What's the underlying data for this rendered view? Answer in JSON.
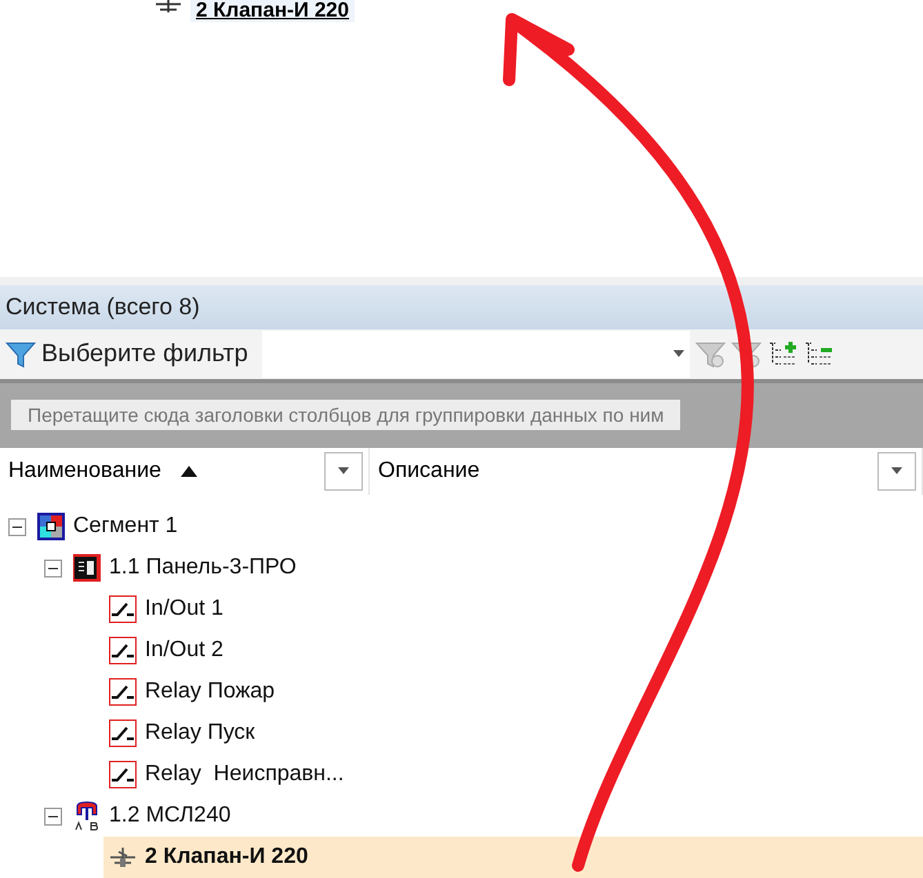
{
  "top_item": {
    "label": "2 Клапан-И 220"
  },
  "panel": {
    "title": "Система (всего 8)"
  },
  "toolbar": {
    "filter_label": "Выберите фильтр"
  },
  "grouping_hint": "Перетащите сюда заголовки столбцов для группировки данных по ним",
  "columns": [
    {
      "label": "Наименование",
      "sorted_ascending": true
    },
    {
      "label": "Описание",
      "sorted_ascending": false
    }
  ],
  "tree": [
    {
      "kind": "segment",
      "label": "Сегмент 1",
      "expanded": true,
      "selected": false,
      "children": [
        {
          "kind": "panel",
          "label": "1.1 Панель-3-ПРО",
          "expanded": true,
          "selected": false,
          "children": [
            {
              "kind": "relay",
              "label": "In/Out 1",
              "selected": false
            },
            {
              "kind": "relay",
              "label": "In/Out 2",
              "selected": false
            },
            {
              "kind": "relay",
              "label": "Relay Пожар",
              "selected": false
            },
            {
              "kind": "relay",
              "label": "Relay Пуск",
              "selected": false
            },
            {
              "kind": "relay",
              "label": "Relay  Неисправн...",
              "selected": false
            }
          ]
        },
        {
          "kind": "module",
          "label": "1.2 МСЛ240",
          "expanded": true,
          "selected": false,
          "children": [
            {
              "kind": "valve",
              "label": "2 Клапан-И 220",
              "selected": true
            }
          ]
        }
      ]
    }
  ]
}
